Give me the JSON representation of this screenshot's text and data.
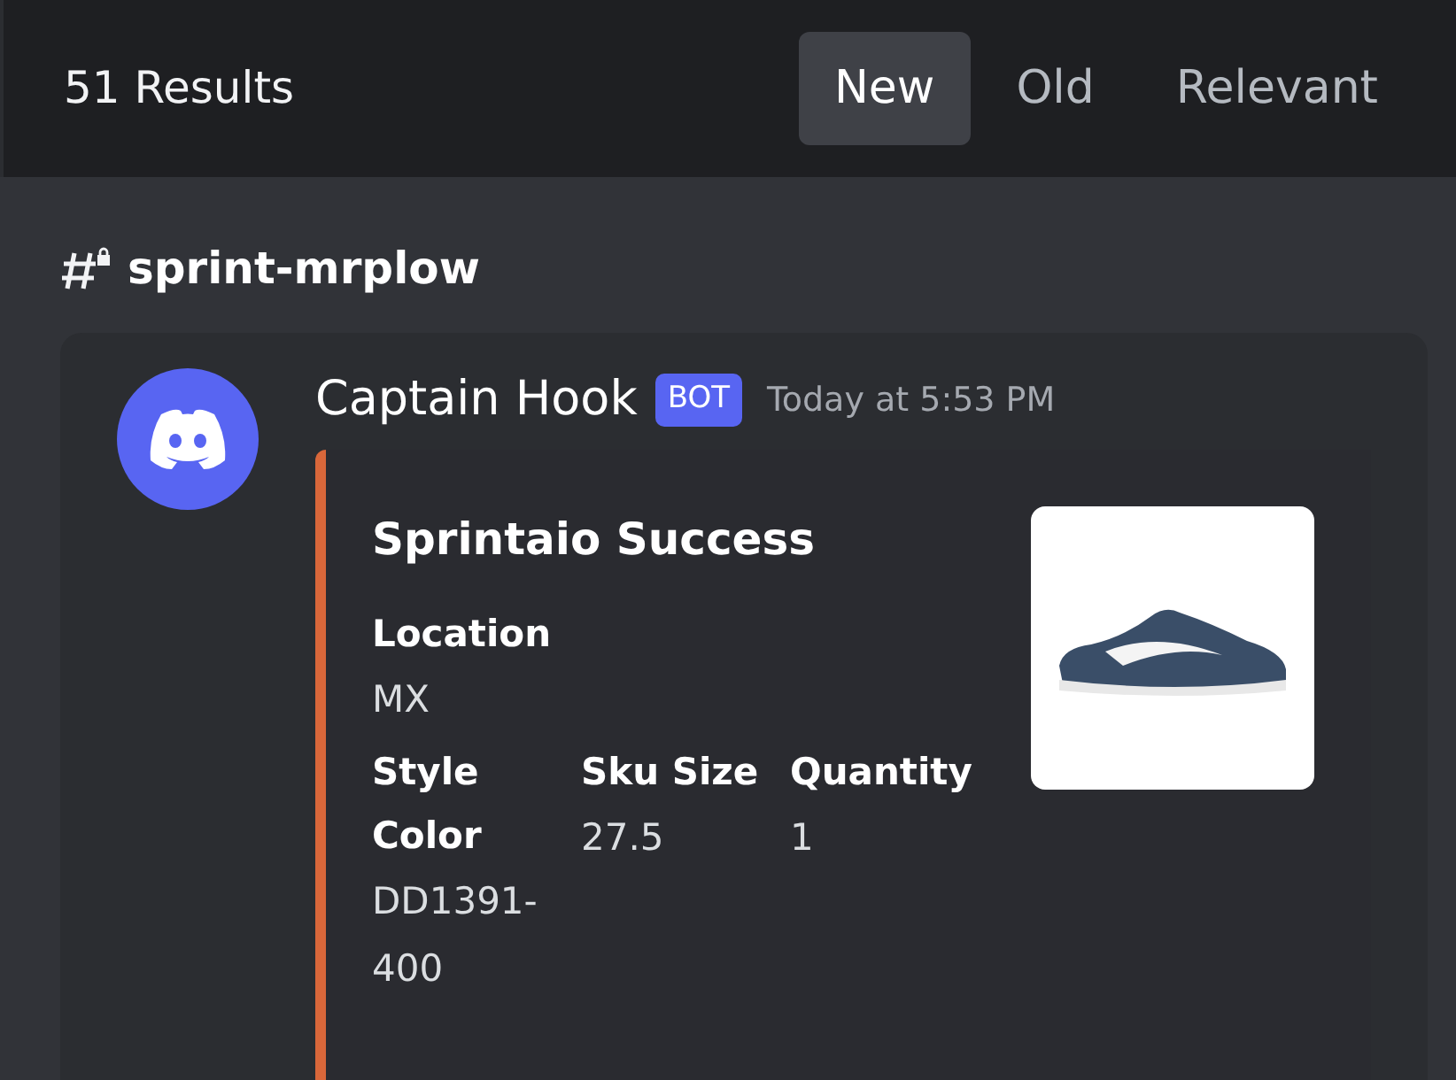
{
  "header": {
    "results": "51 Results",
    "sort_tabs": [
      {
        "label": "New",
        "selected": true
      },
      {
        "label": "Old",
        "selected": false
      },
      {
        "label": "Relevant",
        "selected": false
      }
    ]
  },
  "channel": {
    "name": "sprint-mrplow"
  },
  "message": {
    "author": "Captain Hook",
    "badge": "BOT",
    "timestamp": "Today at 5:53 PM",
    "embed": {
      "color": "#d9673a",
      "title": "Sprintaio Success",
      "fields": [
        {
          "name": "Location",
          "value": "MX",
          "inline": false
        },
        {
          "name": "Style Color",
          "value": "DD1391-400",
          "inline": true
        },
        {
          "name": "Sku Size",
          "value": "27.5",
          "inline": true
        },
        {
          "name": "Quantity",
          "value": "1",
          "inline": true
        }
      ]
    }
  }
}
